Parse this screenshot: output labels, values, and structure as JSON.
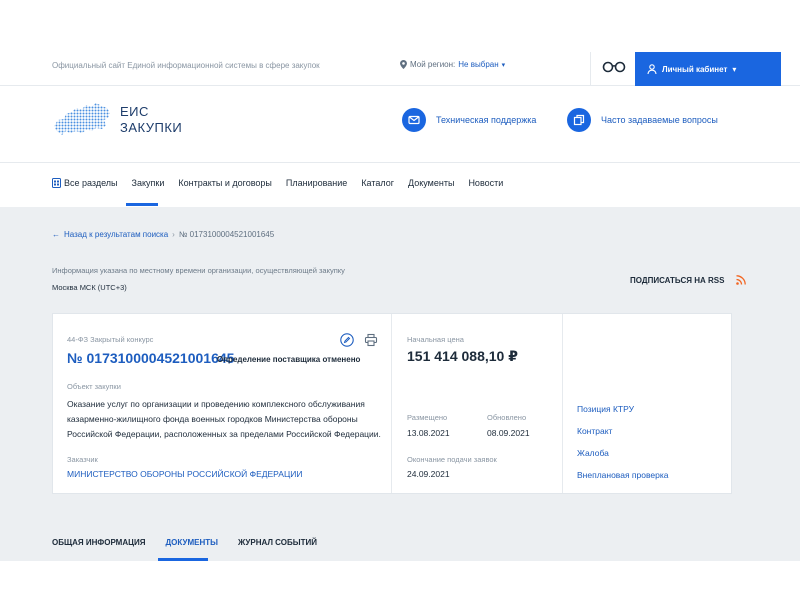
{
  "header": {
    "site_description": "Официальный сайт Единой информационной системы в сфере закупок",
    "region_label": "Мой регион:",
    "region_value": "Не выбран",
    "vision_icon": "glasses-icon",
    "cabinet_label": "Личный кабинет"
  },
  "logo": {
    "line1": "ЕИС",
    "line2": "ЗАКУПКИ"
  },
  "quick_links": {
    "support": "Техническая поддержка",
    "faq": "Часто задаваемые вопросы"
  },
  "nav": {
    "items": [
      "Все разделы",
      "Закупки",
      "Контракты и договоры",
      "Планирование",
      "Каталог",
      "Документы",
      "Новости"
    ],
    "active": "Закупки"
  },
  "breadcrumb": {
    "back": "Назад к результатам поиска",
    "separator": "›",
    "current": "№ 0173100004521001645"
  },
  "time_info": {
    "note": "Информация указана по местному времени организации, осуществляющей закупку",
    "zone": "Москва МСК (UTC+3)"
  },
  "rss_label": "ПОДПИСАТЬСЯ НА RSS",
  "purchase": {
    "law": "44-ФЗ Закрытый конкурс",
    "number": "№ 0173100004521001645",
    "status": "Определение поставщика отменено",
    "object_label": "Объект закупки",
    "object_text": "Оказание услуг по организации и проведению комплексного обслуживания казарменно-жилищного фонда военных городков Министерства обороны Российской Федерации, расположенных за пределами Российской Федерации.",
    "customer_label": "Заказчик",
    "customer_name": "МИНИСТЕРСТВО ОБОРОНЫ РОССИЙСКОЙ ФЕДЕРАЦИИ",
    "price_label": "Начальная цена",
    "price": "151 414 088,10 ₽",
    "published_label": "Размещено",
    "published": "13.08.2021",
    "updated_label": "Обновлено",
    "updated": "08.09.2021",
    "deadline_label": "Окончание подачи заявок",
    "deadline": "24.09.2021"
  },
  "side_links": [
    "Позиция КТРУ",
    "Контракт",
    "Жалоба",
    "Внеплановая проверка"
  ],
  "tabs": {
    "items": [
      "ОБЩАЯ ИНФОРМАЦИЯ",
      "ДОКУМЕНТЫ",
      "ЖУРНАЛ СОБЫТИЙ"
    ],
    "active": "ДОКУМЕНТЫ"
  },
  "colors": {
    "accent": "#1a66e0",
    "link": "#1d5dbf",
    "rss": "#f26522",
    "gray_bg": "#eceff2"
  }
}
